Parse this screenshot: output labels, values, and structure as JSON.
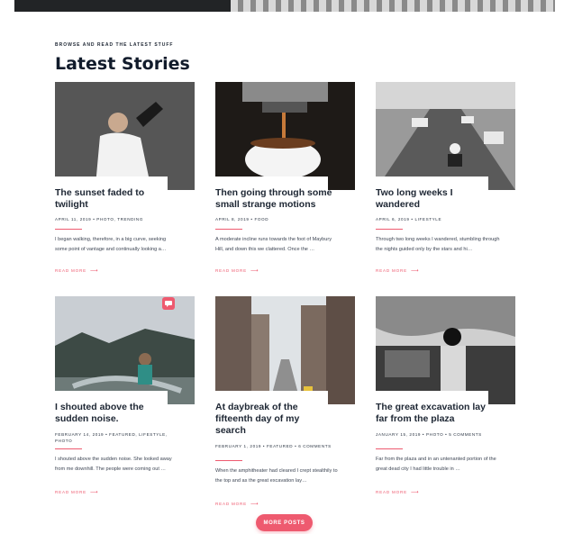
{
  "section": {
    "eyebrow": "BROWSE AND READ THE LATEST STUFF",
    "title": "Latest Stories"
  },
  "posts": [
    {
      "title": "The sunset faded to twilight",
      "meta": "APRIL 11, 2019 • PHOTO, TRENDING",
      "excerpt": "I began walking, therefore, in a big curve, seeking some point of vantage and continually looking a…",
      "read_more": "READ MORE"
    },
    {
      "title": "Then going through some small strange motions",
      "meta": "APRIL 8, 2019 • FOOD",
      "excerpt": "A moderate incline runs towards the foot of Maybury Hill, and down this we clattered. Once the …",
      "read_more": "READ MORE"
    },
    {
      "title": "Two long weeks I wandered",
      "meta": "APRIL 6, 2019 • LIFESTYLE",
      "excerpt": "Through two long weeks I wandered, stumbling through the nights guided only by the stars and hi…",
      "read_more": "READ MORE"
    },
    {
      "title": "I shouted above the sudden noise.",
      "meta": "FEBRUARY 14, 2019 • FEATURED, LIFESTYLE, PHOTO",
      "excerpt": "I shouted above the sudden noise. She looked away from me downhill. The people were coming out …",
      "read_more": "READ MORE"
    },
    {
      "title": "At daybreak of the fifteenth day of my search",
      "meta": "FEBRUARY 1, 2019 • FEATURED • 6 COMMENTS",
      "excerpt": "When the amphitheater had cleared I crept stealthily to the top and as the great excavation lay…",
      "read_more": "READ MORE"
    },
    {
      "title": "The great excavation lay far from the plaza",
      "meta": "JANUARY 15, 2019 • PHOTO • 5 COMMENTS",
      "excerpt": "Far from the plaza and in an untenanted portion of the great dead city I had little trouble in …",
      "read_more": "READ MORE"
    }
  ],
  "more_button": "MORE POSTS",
  "colors": {
    "accent": "#ee5a6f",
    "heading": "#111b2b"
  },
  "icons": {
    "arrow": "arrow-right-icon",
    "chat": "chat-bubble-icon"
  }
}
